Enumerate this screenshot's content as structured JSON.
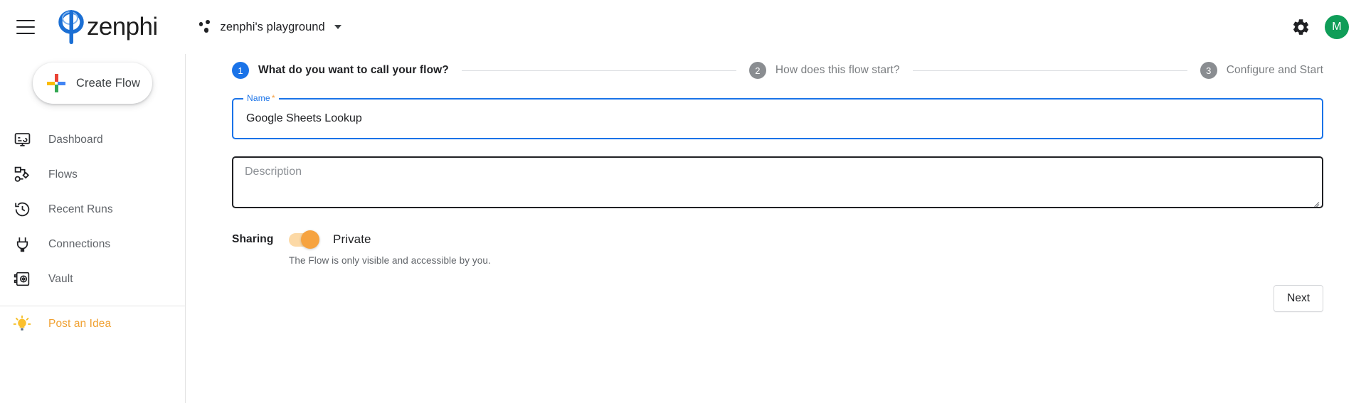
{
  "topbar": {
    "menu_icon": "hamburger-menu-icon",
    "brand_name": "zenphi",
    "brand_logo_icon": "zenphi-phi-logo-icon",
    "workspace_name": "zenphi's playground",
    "workspace_icon": "workspace-dots-icon",
    "workspace_caret_icon": "chevron-down-icon",
    "settings_icon": "gear-icon",
    "avatar_initial": "M",
    "avatar_color": "#0f9d58"
  },
  "sidebar": {
    "create_flow_label": "Create Flow",
    "create_flow_icon": "google-plus-icon",
    "items": [
      {
        "label": "Dashboard",
        "icon": "dashboard-monitor-icon"
      },
      {
        "label": "Flows",
        "icon": "flow-nodes-icon"
      },
      {
        "label": "Recent Runs",
        "icon": "history-clock-icon"
      },
      {
        "label": "Connections",
        "icon": "plug-icon"
      },
      {
        "label": "Vault",
        "icon": "vault-safe-icon"
      }
    ],
    "footer_item": {
      "label": "Post an Idea",
      "icon": "lightbulb-icon",
      "color": "#f0a030"
    }
  },
  "stepper": {
    "steps": [
      {
        "number": "1",
        "label": "What do you want to call your flow?",
        "state": "active"
      },
      {
        "number": "2",
        "label": "How does this flow start?",
        "state": "inactive"
      },
      {
        "number": "3",
        "label": "Configure and Start",
        "state": "inactive"
      }
    ],
    "active_color": "#1a73e8",
    "inactive_color": "#8a8d91"
  },
  "form": {
    "name_label": "Name",
    "name_required_marker": "*",
    "name_value": "Google Sheets Lookup",
    "name_placeholder": "Name",
    "description_value": "",
    "description_placeholder": "Description",
    "sharing_label": "Sharing",
    "sharing_state_label": "Private",
    "sharing_toggle_color": "#f6a340",
    "sharing_hint": "The Flow is only visible and accessible by you."
  },
  "actions": {
    "next_label": "Next"
  }
}
